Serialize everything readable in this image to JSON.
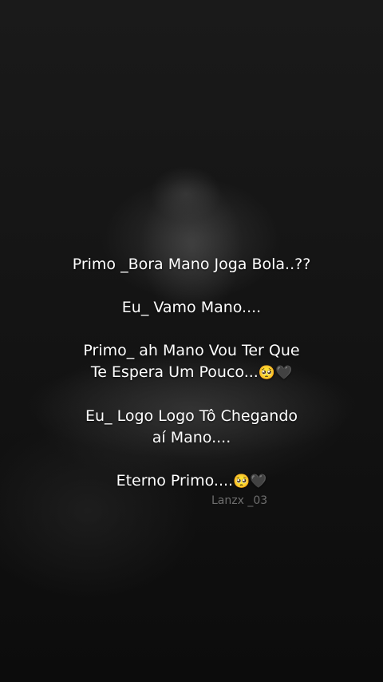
{
  "lines": [
    "Primo _Bora Mano Joga Bola..??",
    "Eu_ Vamo Mano....",
    "Primo_ ah Mano Vou Ter Que",
    "Te Espera Um Pouco...",
    "Eu_ Logo Logo Tô Chegando",
    "aí Mano....",
    "Eterno Primo...."
  ],
  "emojis": {
    "pleading_face": "🥺",
    "black_heart": "🖤"
  },
  "watermark": "Lanzx _03"
}
